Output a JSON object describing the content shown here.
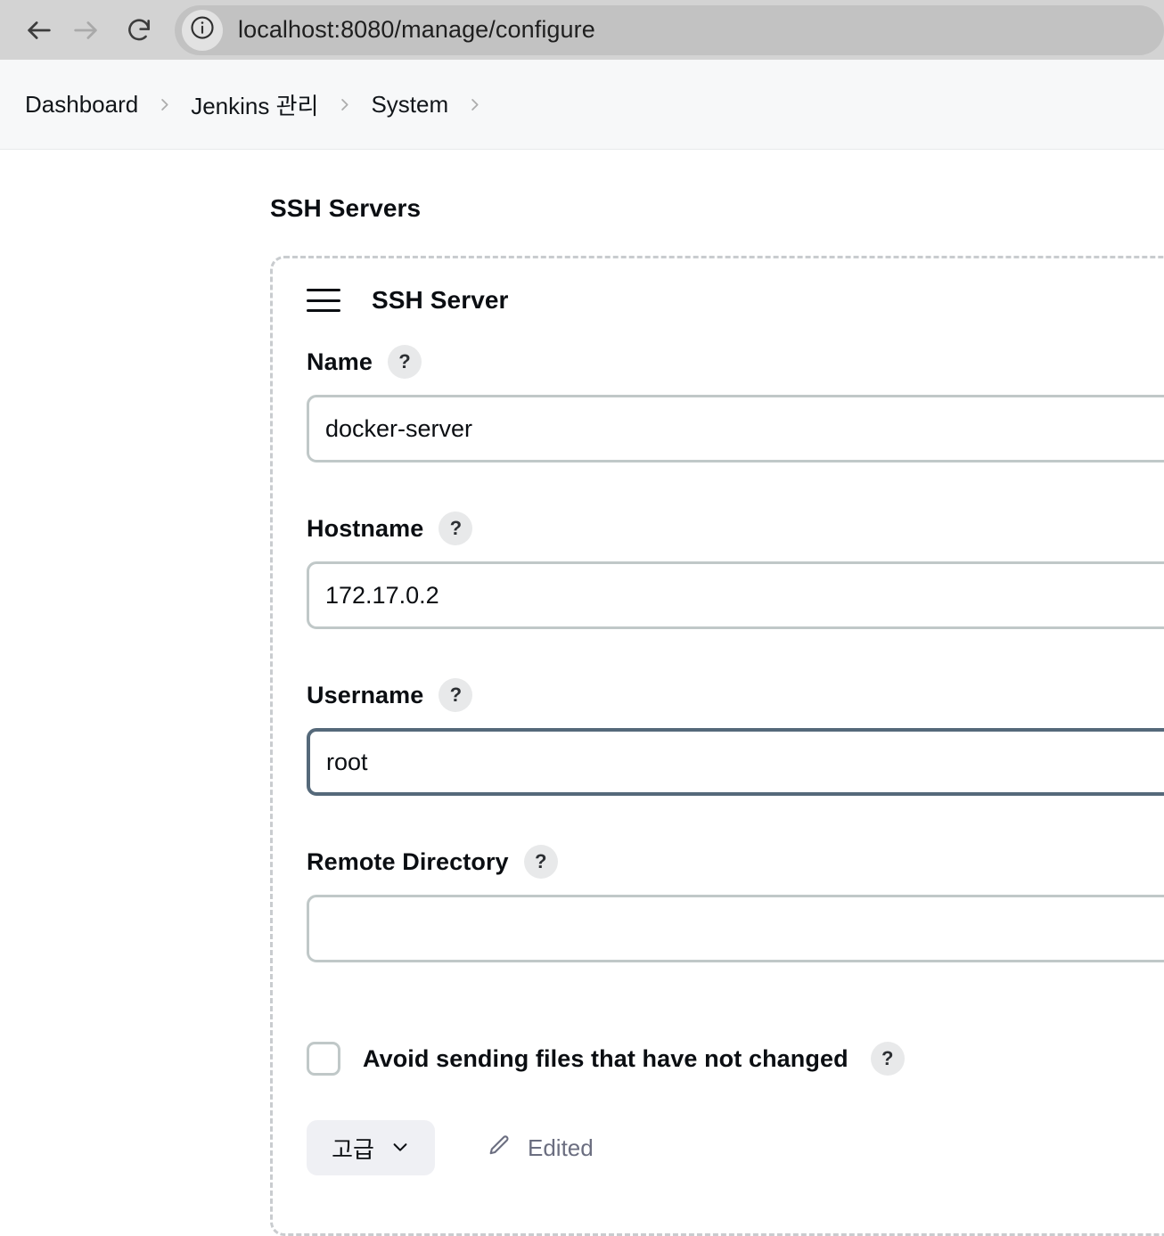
{
  "browser": {
    "back_icon": "arrow-left-icon",
    "forward_icon": "arrow-right-icon",
    "reload_icon": "reload-icon",
    "site_info_icon": "info-circle-icon",
    "url": "localhost:8080/manage/configure"
  },
  "breadcrumb": {
    "items": [
      {
        "label": "Dashboard"
      },
      {
        "label": "Jenkins 관리"
      },
      {
        "label": "System"
      }
    ],
    "separator_icon": "chevron-right-icon"
  },
  "main": {
    "section_title": "SSH Servers",
    "card": {
      "drag_handle_icon": "drag-handle-icon",
      "title": "SSH Server",
      "help_icon": "question-mark-icon",
      "fields": [
        {
          "label": "Name",
          "value": "docker-server",
          "placeholder": "",
          "focused": false
        },
        {
          "label": "Hostname",
          "value": "172.17.0.2",
          "placeholder": "",
          "focused": false
        },
        {
          "label": "Username",
          "value": "root",
          "placeholder": "",
          "focused": true
        },
        {
          "label": "Remote Directory",
          "value": "",
          "placeholder": "",
          "focused": false
        }
      ],
      "checkbox": {
        "label": "Avoid sending files that have not changed",
        "checked": false
      },
      "footer": {
        "advanced_label": "고급",
        "advanced_chevron_icon": "chevron-down-icon",
        "edited_icon": "pencil-icon",
        "edited_label": "Edited"
      }
    }
  },
  "colors": {
    "browser_bar": "#d3d3d3",
    "url_pill": "#c2c2c2",
    "breadcrumb_bg": "#f7f8f9",
    "input_border": "#c0c8c8",
    "input_border_focus": "#55697a",
    "card_dash_border": "#c9cccf",
    "help_badge_bg": "#e8e9ea",
    "advanced_btn_bg": "#eff0f4",
    "edited_text": "#6b6e80",
    "text_primary": "#0b0e12"
  }
}
